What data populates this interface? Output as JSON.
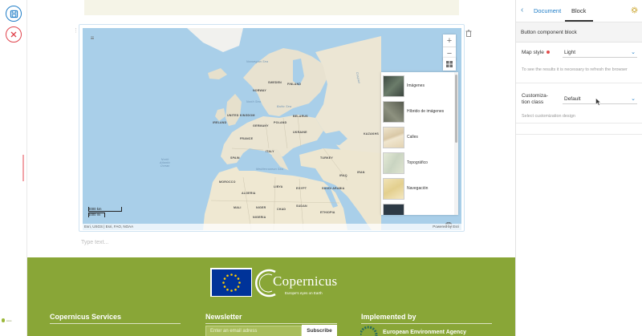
{
  "toolbar": {
    "save_icon": "save-icon",
    "cancel_icon": "close-icon",
    "accent": "#1f7dc7",
    "cancel_color": "#e0434c"
  },
  "editor": {
    "type_text_placeholder": "Type text..."
  },
  "map": {
    "labels": {
      "norwegian_sea": "Norwegian\nSea",
      "sweden": "SWEDEN",
      "finland": "FINLAND",
      "norway": "NORWAY",
      "north_sea": "North\nSea",
      "baltic_sea": "Baltic Sea",
      "united_kingdom": "UNITED\nKINGDOM",
      "ireland": "IRELAND",
      "germany": "GERMANY",
      "poland": "POLAND",
      "belarus": "BELARUS",
      "france": "FRANCE",
      "ukraine": "UKRAINE",
      "kazakhstan": "KAZAKHS",
      "spain": "SPAIN",
      "italy": "ITALY",
      "turkey": "TURKEY",
      "iraq": "IRAQ",
      "morocco": "MOROCCO",
      "algeria": "ALGERIA",
      "libya": "LIBYA",
      "egypt": "EGYPT",
      "saudi_arabia": "SAUDI\nARABIA",
      "mali": "MALI",
      "niger": "NIGER",
      "sudan": "SUDAN",
      "chad": "CHAD",
      "ethiopia": "ETHIOPIA",
      "nigeria": "NIGERIA",
      "north_atlantic": "North\nAtlantic\nOcean",
      "mediterranean": "Mediterranean Sea",
      "iran": "IRAN",
      "caspian": "Caspian"
    },
    "basemaps": [
      {
        "label": "Imágenes",
        "thumb_color": "#4f5a52"
      },
      {
        "label": "Híbrido de imágenes",
        "thumb_color": "#6b7060"
      },
      {
        "label": "Calles",
        "thumb_color": "#e9dfc8"
      },
      {
        "label": "Topográfico",
        "thumb_color": "#dfe6d2"
      },
      {
        "label": "Navegación",
        "thumb_color": "#efe1b4"
      },
      {
        "label": "",
        "thumb_color": "#2d3a45"
      }
    ],
    "scale_km": "2000 km",
    "scale_mi": "1000 mi",
    "attribution": "Esri, USGS | Esri, FAO, NOAA",
    "powered_by": "Powered by Esri",
    "menu_icon": "hamburger-menu-icon",
    "zoom_in": "+",
    "zoom_out": "−"
  },
  "footer": {
    "copernicus": "Copernicus",
    "tagline": "Europe's eyes on Earth",
    "services_heading": "Copernicus Services",
    "newsletter_heading": "Newsletter",
    "implemented_heading": "Implemented by",
    "email_placeholder": "Enter an email adress",
    "subscribe_label": "Subscribe",
    "eea_partial": "European Environment Agency",
    "background": "#89a637"
  },
  "sidebar": {
    "tab_document": "Document",
    "tab_block": "Block",
    "section_title": "Button component block",
    "map_style_label": "Map style",
    "map_style_value": "Light",
    "map_style_help": "To see the results it is necessary to refresh the browser",
    "customization_label": "Customiza-\ntion class",
    "customization_value": "Default",
    "customization_help": "Select customization design"
  }
}
